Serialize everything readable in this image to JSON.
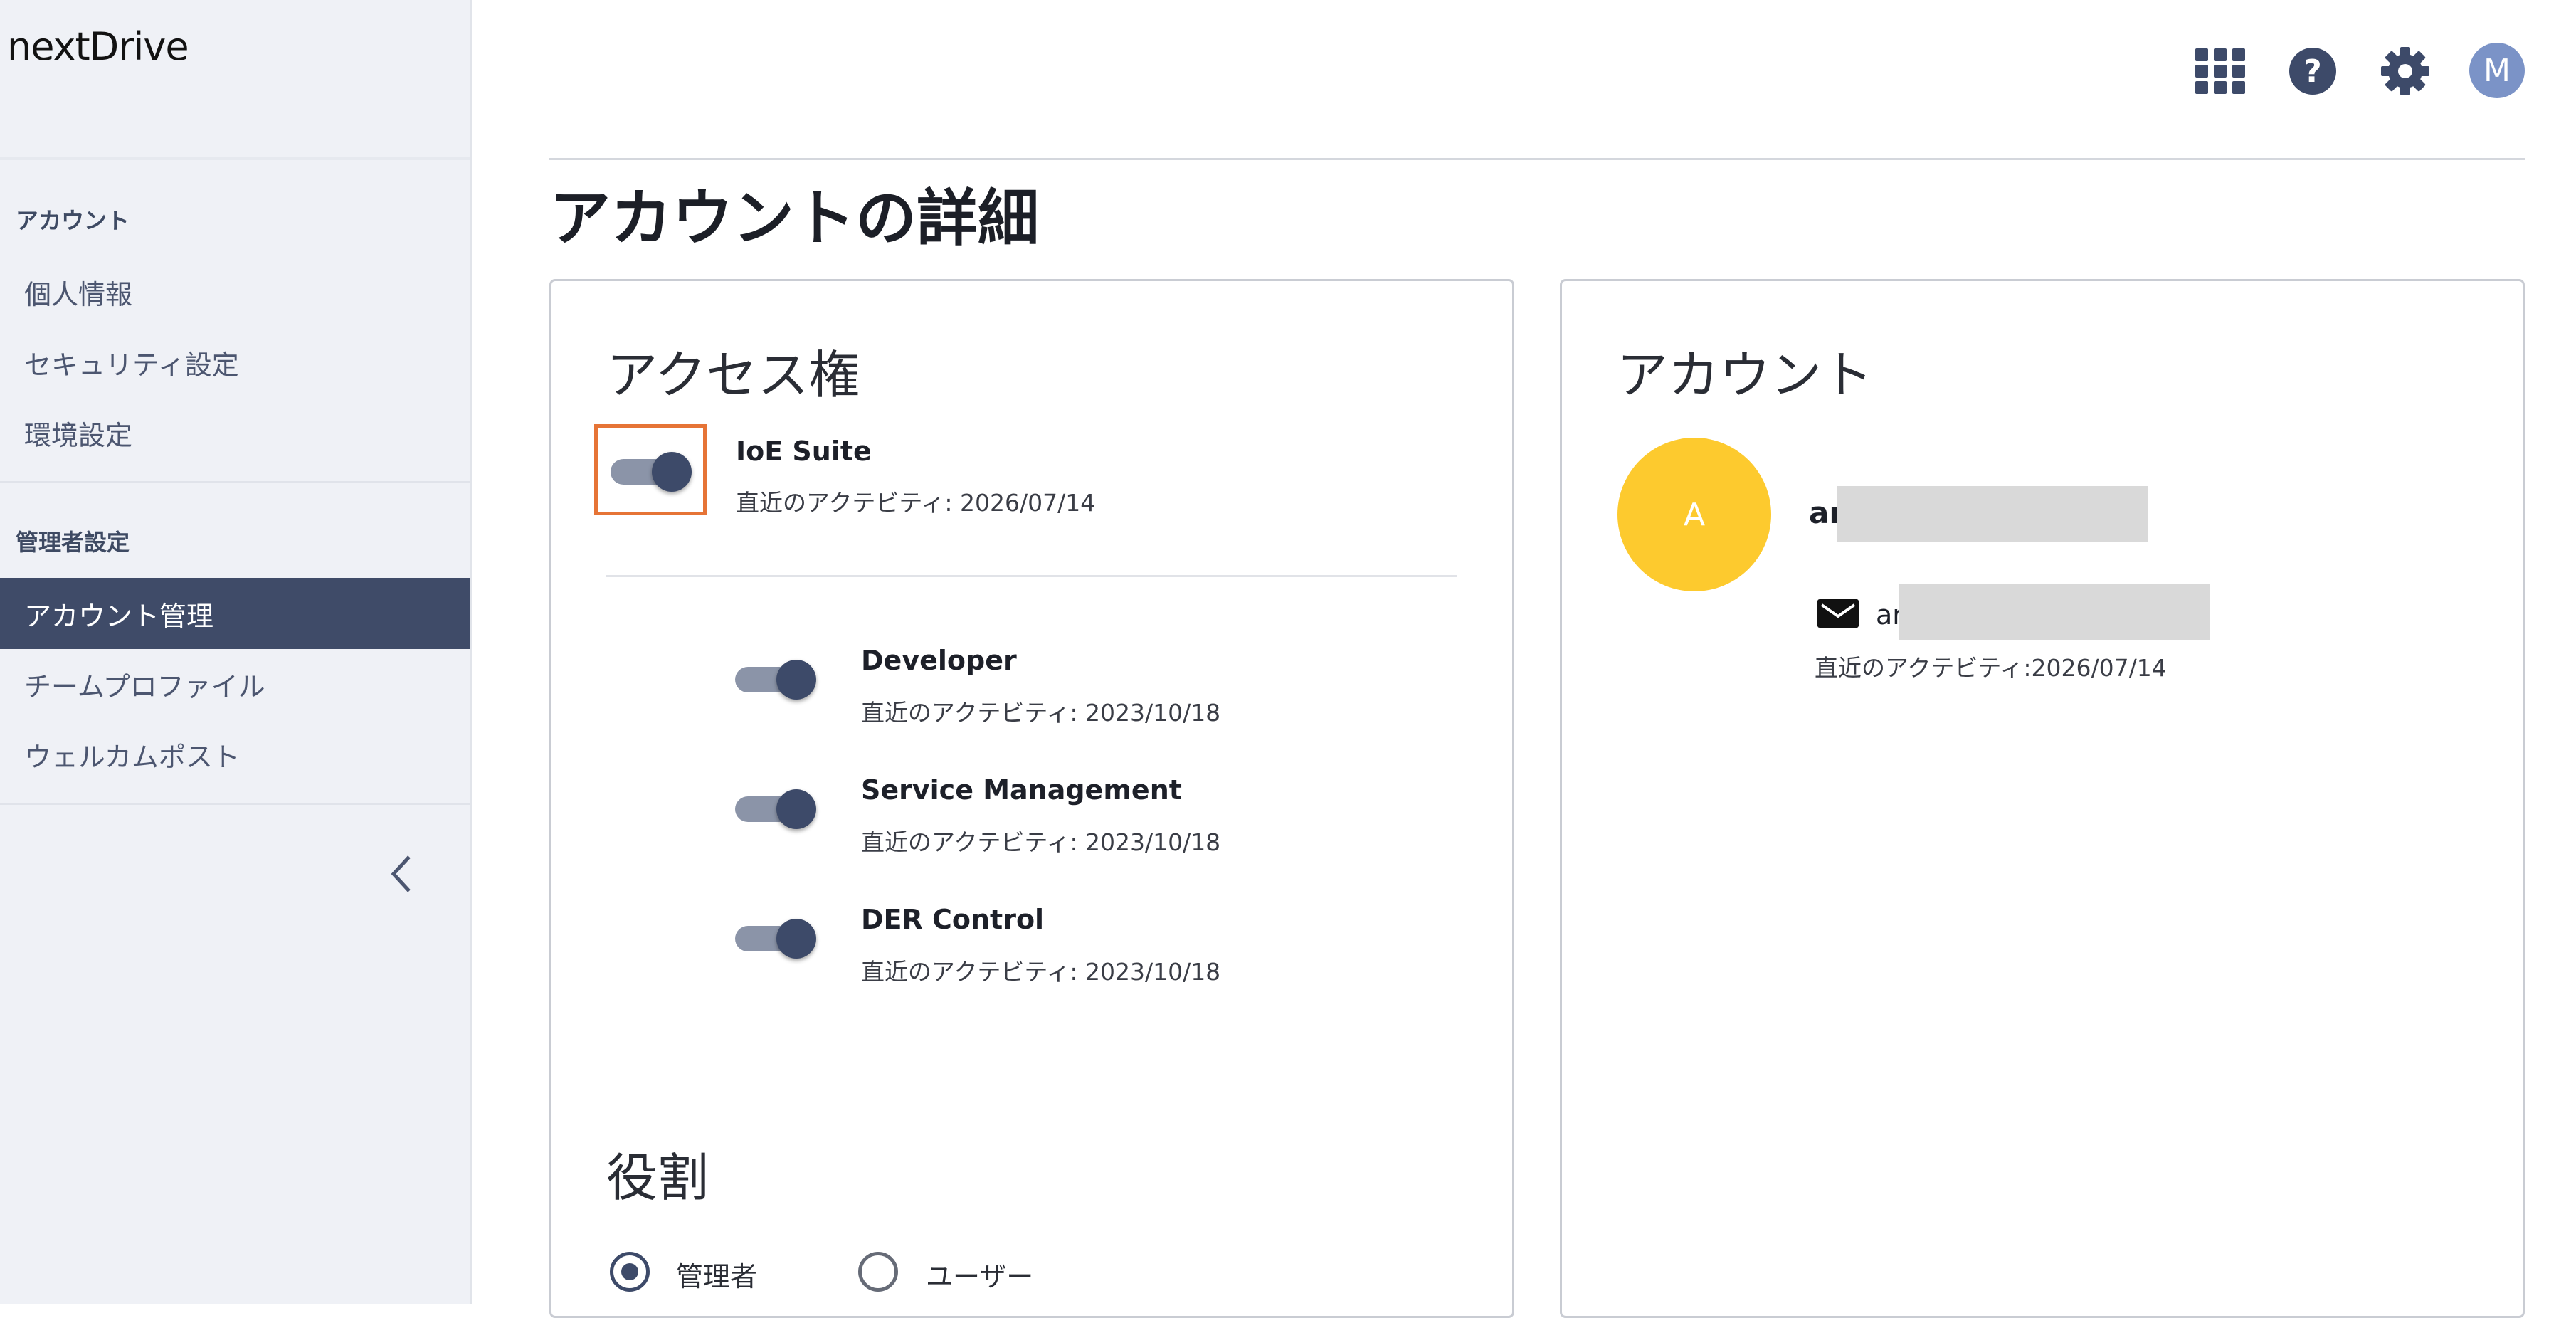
{
  "brand": {
    "logo_text": "nextDrive"
  },
  "sidebar": {
    "account_section": "アカウント",
    "items_account": [
      {
        "label": "個人情報"
      },
      {
        "label": "セキュリティ設定"
      },
      {
        "label": "環境設定"
      }
    ],
    "admin_section": "管理者設定",
    "items_admin": [
      {
        "label": "アカウント管理",
        "active": true
      },
      {
        "label": "チームプロファイル"
      },
      {
        "label": "ウェルカムポスト"
      }
    ],
    "collapse_icon": "chevron-left-icon"
  },
  "topbar": {
    "icons": [
      "apps-grid-icon",
      "help-icon",
      "gear-icon"
    ],
    "avatar_initial": "M",
    "avatar_color": "#7b93c7"
  },
  "page": {
    "title": "アカウントの詳細"
  },
  "access": {
    "heading": "アクセス権",
    "main": {
      "name": "IoE Suite",
      "activity": "直近のアクテビティ: 2026/07/14",
      "enabled": true
    },
    "sub": [
      {
        "name": "Developer",
        "activity": "直近のアクテビティ: 2023/10/18",
        "enabled": true
      },
      {
        "name": "Service Management",
        "activity": "直近のアクテビティ: 2023/10/18",
        "enabled": true
      },
      {
        "name": "DER Control",
        "activity": "直近のアクテビティ: 2023/10/18",
        "enabled": true
      }
    ]
  },
  "role": {
    "heading": "役割",
    "options": [
      {
        "label": "管理者",
        "selected": true
      },
      {
        "label": "ユーザー",
        "selected": false
      }
    ]
  },
  "account": {
    "heading": "アカウント",
    "avatar_initial": "A",
    "avatar_color": "#fdca2e",
    "name_visible": "ar",
    "email_visible": "ar",
    "activity": "直近のアクテビティ:2026/07/14"
  },
  "colors": {
    "sidebar_active": "#3f4b68",
    "highlight": "#e67436",
    "toggle_knob": "#3d4a69"
  }
}
